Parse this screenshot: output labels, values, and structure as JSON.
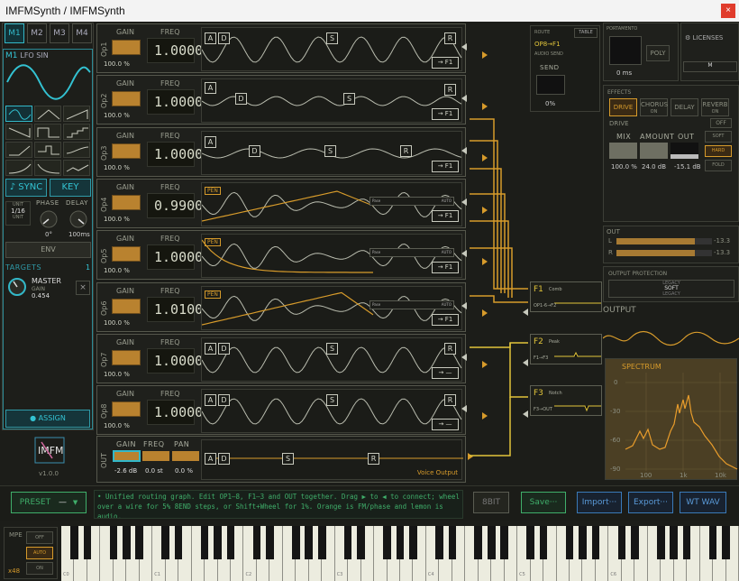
{
  "window": {
    "title": "IMFMSynth / IMFMSynth",
    "close": "×"
  },
  "mod": {
    "tabs": [
      "M1",
      "M2",
      "M3",
      "M4"
    ],
    "header_id": "M1",
    "header_text": "LFO SIN",
    "sync": "♪ SYNC",
    "key": "KEY",
    "unit_top": "UNIT",
    "rate": "1/16",
    "unit_bottom": "UNIT",
    "phase_label": "PHASE",
    "delay_label": "DELAY",
    "phase_value": "0°",
    "delay_value": "100ms",
    "env": "ENV",
    "targets_label": "TARGETS",
    "targets_count": "1",
    "target_name": "MASTER",
    "target_param": "GAIN",
    "target_value": "0.454",
    "assign": "● ASSIGN"
  },
  "logo": {
    "text": "IMFM",
    "version": "v1.0.0"
  },
  "operators": [
    {
      "name": "Op1",
      "gain_label": "GAIN",
      "freq_label": "FREQ",
      "freq": "1.0000",
      "gain": "100.0 %",
      "env": [
        "A",
        "D",
        "S",
        "R"
      ],
      "route": "→ F1",
      "pen": ""
    },
    {
      "name": "Op2",
      "gain_label": "GAIN",
      "freq_label": "FREQ",
      "freq": "1.0000",
      "gain": "100.0 %",
      "env": [
        "A",
        "D",
        "S",
        "R"
      ],
      "route": "→ F1",
      "pen": ""
    },
    {
      "name": "Op3",
      "gain_label": "GAIN",
      "freq_label": "FREQ",
      "freq": "1.0000",
      "gain": "100.0 %",
      "env": [
        "A",
        "D",
        "S",
        "R"
      ],
      "route": "→ F1",
      "pen": ""
    },
    {
      "name": "Op4",
      "gain_label": "GAIN",
      "freq_label": "FREQ",
      "freq": "0.9900",
      "gain": "100.0 %",
      "env": [],
      "route": "→ F1",
      "pen": "PEN"
    },
    {
      "name": "Op5",
      "gain_label": "GAIN",
      "freq_label": "FREQ",
      "freq": "1.0000",
      "gain": "100.0 %",
      "env": [],
      "route": "→ F1",
      "pen": "PEN"
    },
    {
      "name": "Op6",
      "gain_label": "GAIN",
      "freq_label": "FREQ",
      "freq": "1.0100",
      "gain": "100.0 %",
      "env": [],
      "route": "→ F1",
      "pen": "PEN"
    },
    {
      "name": "Op7",
      "gain_label": "GAIN",
      "freq_label": "FREQ",
      "freq": "1.0000",
      "gain": "100.0 %",
      "env": [
        "A",
        "D",
        "S",
        "R"
      ],
      "route": "→ —",
      "pen": ""
    },
    {
      "name": "Op8",
      "gain_label": "GAIN",
      "freq_label": "FREQ",
      "freq": "1.0000",
      "gain": "100.0 %",
      "env": [
        "A",
        "D",
        "S",
        "R"
      ],
      "route": "→ —",
      "pen": ""
    }
  ],
  "pen_controls": {
    "label": "Pase",
    "auto": "AUTO"
  },
  "out": {
    "name": "OUT",
    "gain_label": "GAIN",
    "freq_label": "FREQ",
    "pan_label": "PAN",
    "gain": "-2.6 dB",
    "freq": "0.0 st",
    "pan": "0.0 %",
    "env": [
      "A",
      "D",
      "S",
      "R"
    ],
    "voice_output": "Voice Output"
  },
  "filters": [
    {
      "id": "F1",
      "type": "Comb",
      "route": "OP1-6→F2"
    },
    {
      "id": "F2",
      "type": "Peak",
      "route": "F1→F3"
    },
    {
      "id": "F3",
      "type": "Notch",
      "route": "F3→OUT"
    }
  ],
  "route_box": {
    "title": "ROUTE",
    "table": "TABLE",
    "source": "OP8→F1",
    "sub": "AUDIO SEND",
    "send": "SEND",
    "value": "0%"
  },
  "portamento": {
    "title": "PORTAMENTO",
    "poly": "POLY",
    "time": "0 ms"
  },
  "licenses": "⚙ LICENSES",
  "effects": {
    "title": "EFFECTS",
    "tabs": [
      {
        "name": "DRIVE",
        "sub": ""
      },
      {
        "name": "CHORUS",
        "sub": "ON"
      },
      {
        "name": "DELAY",
        "sub": ""
      },
      {
        "name": "REVERB",
        "sub": "ON"
      }
    ],
    "drive_label": "DRIVE",
    "off": "OFF",
    "mix_label": "MIX",
    "amount_label": "AMOUNT",
    "out_label": "OUT",
    "mix": "100.0 %",
    "amount": "24.0 dB",
    "out": "-15.1 dB",
    "modes": [
      "SOFT",
      "HARD",
      "FOLD"
    ]
  },
  "meter": {
    "title": "OUT",
    "l": "L",
    "r": "R",
    "l_db": "-13.3",
    "r_db": "-13.3",
    "l_level": 0.82,
    "r_level": 0.82
  },
  "protection": {
    "title": "OUTPUT PROTECTION",
    "legacy": "LEGACY",
    "soft": "SOFT",
    "legacy2": "LEGACY"
  },
  "output_label": "OUTPUT",
  "spectrum": {
    "title": "SPECTRUM",
    "y_ticks": [
      "0",
      "-30",
      "-60",
      "-90"
    ],
    "x_ticks": [
      "100",
      "1k",
      "10k"
    ]
  },
  "bottom": {
    "preset": "PRESET",
    "preset_value": "—",
    "help": "• Unified routing graph. Edit OP1–8, F1–3 and OUT together. Drag ▶ to ◀ to connect; wheel over a wire for 5% 8END steps, or Shift+Wheel for 1%. Orange is FM/phase and lemon is audio.",
    "bit8": "8BIT",
    "save": "Save···",
    "import": "Import···",
    "export": "Export···",
    "wtwav": "WT WAV"
  },
  "mpe": {
    "title": "MPE",
    "off": "OFF",
    "auto": "AUTO",
    "on": "ON",
    "x48": "x48"
  },
  "keys": {
    "labels": [
      "C0",
      "C1",
      "C2",
      "C3",
      "C4",
      "C5",
      "C6"
    ]
  },
  "colors": {
    "accent_cyan": "#33b8c8",
    "orange": "#d79b2b",
    "lemon": "#e1c43a",
    "panel": "#1f201c"
  }
}
